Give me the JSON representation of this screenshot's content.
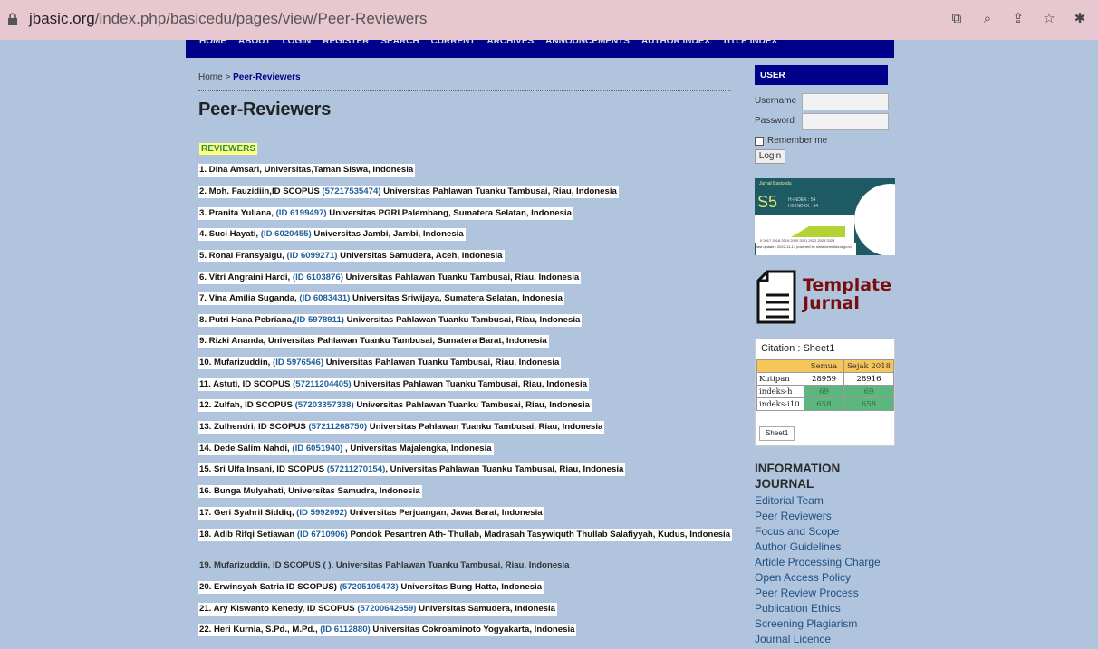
{
  "browser": {
    "url_domain": "jbasic.org",
    "url_path": "/index.php/basicedu/pages/view/Peer-Reviewers"
  },
  "nav": {
    "items": [
      "HOME",
      "ABOUT",
      "LOGIN",
      "REGISTER",
      "SEARCH",
      "CURRENT",
      "ARCHIVES",
      "ANNOUNCEMENTS",
      "AUTHOR INDEX",
      "TITLE INDEX"
    ]
  },
  "breadcrumb": {
    "home": "Home",
    "sep": " > ",
    "current": "Peer-Reviewers"
  },
  "page_title": "Peer-Reviewers",
  "section_label": "REVIEWERS",
  "reviewers": [
    {
      "pre": "1. Dina Amsari, Universitas,Taman Siswa, Indonesia",
      "id": "",
      "post": ""
    },
    {
      "pre": "2. Moh. Fauzidiin,ID SCOPUS ",
      "id": "(57217535474)",
      "post": " Universitas Pahlawan Tuanku Tambusai, Riau, Indonesia"
    },
    {
      "pre": "3. Pranita Yuliana, ",
      "id": "(ID 6199497)",
      "post": "  Universitas PGRI Palembang, Sumatera Selatan, Indonesia"
    },
    {
      "pre": "4. Suci Hayati, ",
      "id": "(ID 6020455)",
      "post": "  Universitas Jambi, Jambi, Indonesia"
    },
    {
      "pre": "5. Ronal Fransyaigu, ",
      "id": "(ID 6099271)",
      "post": "  Universitas Samudera, Aceh, Indonesia"
    },
    {
      "pre": "6. Vitri Angraini Hardi, ",
      "id": "(ID 6103876)",
      "post": "  Universitas Pahlawan Tuanku Tambusai, Riau, Indonesia"
    },
    {
      "pre": "7. Vina Amilia Suganda, ",
      "id": "(ID 6083431)",
      "post": " Universitas Sriwijaya, Sumatera Selatan, Indonesia"
    },
    {
      "pre": "8. Putri Hana Pebriana,",
      "id": "(ID 5978911)",
      "post": "  Universitas Pahlawan Tuanku Tambusai, Riau, Indonesia"
    },
    {
      "pre": "9. Rizki Ananda,  Universitas Pahlawan Tuanku Tambusai, Sumatera Barat, Indonesia",
      "id": "",
      "post": ""
    },
    {
      "pre": "10. Mufarizuddin, ",
      "id": "(ID 5976546)",
      "post": "  Universitas Pahlawan Tuanku Tambusai, Riau, Indonesia"
    },
    {
      "pre": "11. Astuti, ID SCOPUS ",
      "id": "(57211204405)",
      "post": " Universitas Pahlawan Tuanku Tambusai, Riau, Indonesia"
    },
    {
      "pre": "12. Zulfah, ID SCOPUS ",
      "id": "(57203357338)",
      "post": " Universitas Pahlawan Tuanku Tambusai, Riau, Indonesia"
    },
    {
      "pre": "13. Zulhendri, ID SCOPUS ",
      "id": "(57211268750)",
      "post": "  Universitas Pahlawan Tuanku Tambusai, Riau, Indonesia"
    },
    {
      "pre": "14. Dede Salim Nahdi, ",
      "id": "(ID 6051940)",
      "post": " ,  Universitas Majalengka, Indonesia"
    },
    {
      "pre": "15. Sri Ulfa Insani, ID SCOPUS ",
      "id": "(57211270154)",
      "post": ",  Universitas Pahlawan Tuanku Tambusai, Riau, Indonesia"
    },
    {
      "pre": "16. Bunga Mulyahati,  Universitas Samudra, Indonesia",
      "id": "",
      "post": ""
    },
    {
      "pre": "17. Geri Syahril Siddiq, ",
      "id": "(ID 5992092)",
      "post": "  Universitas Perjuangan, Jawa Barat, Indonesia"
    },
    {
      "pre": "18. Adib Rifqi Setiawan ",
      "id": "(ID 6710906)",
      "post": "  Pondok Pesantren Ath- Thullab, Madrasah Tasywiquth Thullab Salafiyyah, Kudus, Indonesia"
    },
    {
      "pre": "19. Mufarizuddin, ID SCOPUS (  ).  Universitas Pahlawan Tuanku Tambusai, Riau, Indonesia",
      "id": "",
      "post": ""
    },
    {
      "pre": "20. Erwinsyah Satria ID SCOPUS) ",
      "id": "(57205105473)",
      "post": "  Universitas Bung Hatta, Indonesia"
    },
    {
      "pre": "21. Ary Kiswanto Kenedy, ID SCOPUS ",
      "id": "(57200642659)",
      "post": " Universitas Samudera, Indonesia"
    },
    {
      "pre": "22. Heri Kurnia, S.Pd., M.Pd., ",
      "id": "(ID 6112880)",
      "post": " Universitas Cokroaminoto Yogyakarta, Indonesia"
    }
  ],
  "sidebar": {
    "user_head": "USER",
    "username_label": "Username",
    "password_label": "Password",
    "remember_label": "Remember me",
    "login_button": "Login",
    "s5": {
      "title": "Jurnal Basicedu",
      "big": "S5",
      "h_index": "H-INDEX : 54",
      "h5_index": "H5-INDEX : 54",
      "years": "0   2017 2018 2019 2020 2021 2022 2023 2024",
      "footer": "last update : 2022-11-17        powered by sinta.kemdikbud.go.id"
    },
    "template": {
      "line1": "Template",
      "line2": "Jurnal"
    },
    "citation": {
      "title": "Citation : Sheet1",
      "headers": [
        "",
        "Semua",
        "Sejak 2018"
      ],
      "rows": [
        {
          "label": "Kutipan",
          "all": "28959",
          "since": "28916"
        },
        {
          "label": "indeks-h",
          "all": "69",
          "since": "69"
        },
        {
          "label": "indeks-i10",
          "all": "658",
          "since": "658"
        }
      ],
      "tab": "Sheet1"
    },
    "info_title": "INFORMATION JOURNAL",
    "info_links": [
      "Editorial Team",
      "Peer Reviewers",
      "Focus and Scope",
      "Author Guidelines",
      "Article Processing Charge",
      "Open Access Policy",
      "Peer Review Process",
      "Publication Ethics",
      "Screening Plagiarism",
      "Journal Licence"
    ]
  }
}
